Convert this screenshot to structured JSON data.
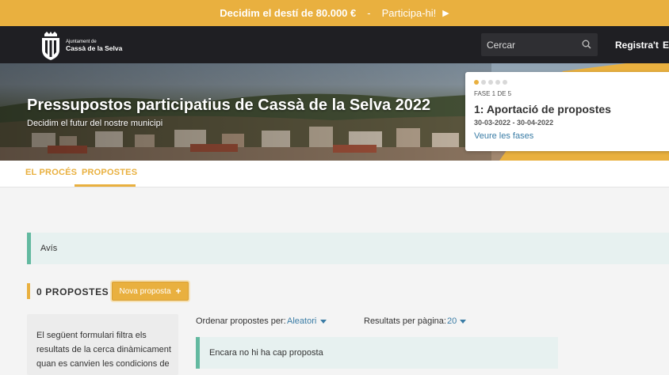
{
  "announcement": {
    "strong_text": "Decidim el destí de 80.000 €",
    "separator": "-",
    "cta": "Participa-hi!",
    "cta_icon": "play-icon"
  },
  "header": {
    "logo": {
      "line1": "Ajuntament de",
      "line2": "Cassà de la Selva",
      "icon": "coat-of-arms-icon"
    },
    "search_placeholder": "Cercar",
    "search_icon": "search-icon",
    "register_label": "Registra't",
    "enter_label": "E"
  },
  "hero": {
    "title": "Pressupostos participatius de Cassà de la Selva 2022",
    "subtitle": "Decidim el futur del nostre municipi"
  },
  "phase": {
    "step_label": "FASE 1 DE 5",
    "total_steps": 5,
    "current_step": 1,
    "name": "1: Aportació de propostes",
    "dates": "30-03-2022 - 30-04-2022",
    "link": "Veure les fases"
  },
  "tabs": [
    {
      "label": "EL PROCÉS",
      "active": false
    },
    {
      "label": "PROPOSTES",
      "active": true
    }
  ],
  "notice": {
    "text": "Avís"
  },
  "proposals": {
    "count_title": "0 PROPOSTES",
    "new_button": "Nova proposta",
    "filter_text": "El següent formulari filtra els resultats de la cerca dinàmicament quan es canvien les condicions de",
    "order_label": "Ordenar propostes per:",
    "order_value": "Aleatori",
    "per_page_label": "Resultats per pàgina:",
    "per_page_value": "20",
    "empty_text": "Encara no hi ha cap proposta"
  },
  "colors": {
    "accent": "#e9b03f",
    "topbar": "#1f1f23",
    "link": "#3a7ca5",
    "notice_border": "#63b9a0",
    "notice_bg": "#e7f1f0"
  }
}
